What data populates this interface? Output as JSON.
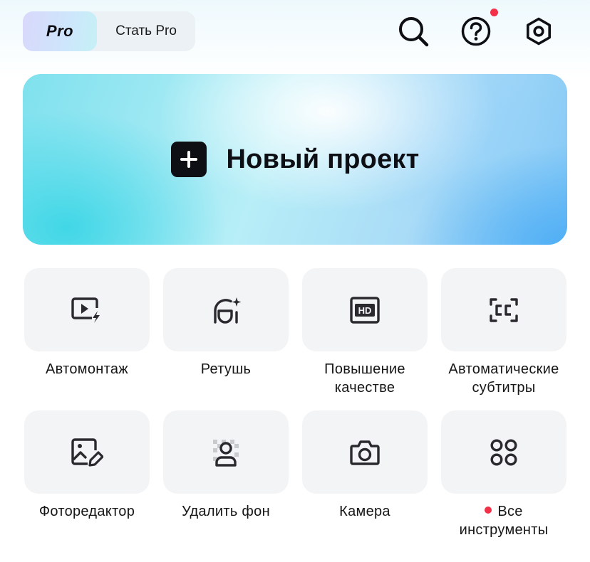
{
  "header": {
    "pro_badge": "Pro",
    "pro_cta": "Стать Pro",
    "icons": {
      "search": "search-icon",
      "help": "help-icon",
      "settings": "settings-icon"
    },
    "help_has_notification": true
  },
  "banner": {
    "icon": "plus-icon",
    "title": "Новый проект"
  },
  "tools": [
    {
      "icon": "auto-edit-icon",
      "label": "Автомонтаж"
    },
    {
      "icon": "retouch-icon",
      "label": "Ретушь"
    },
    {
      "icon": "hd-icon",
      "label": "Повышение\nкачестве"
    },
    {
      "icon": "captions-icon",
      "label": "Автоматические\nсубтитры"
    },
    {
      "icon": "photo-editor-icon",
      "label": "Фоторедактор"
    },
    {
      "icon": "remove-background-icon",
      "label": "Удалить фон"
    },
    {
      "icon": "camera-icon",
      "label": "Камера"
    },
    {
      "icon": "all-tools-icon",
      "label": "Все\nинструменты",
      "has_notification": true
    }
  ],
  "colors": {
    "notification": "#f23048",
    "tile_background": "#f3f4f6",
    "icon_stroke": "#2a2a2e"
  }
}
